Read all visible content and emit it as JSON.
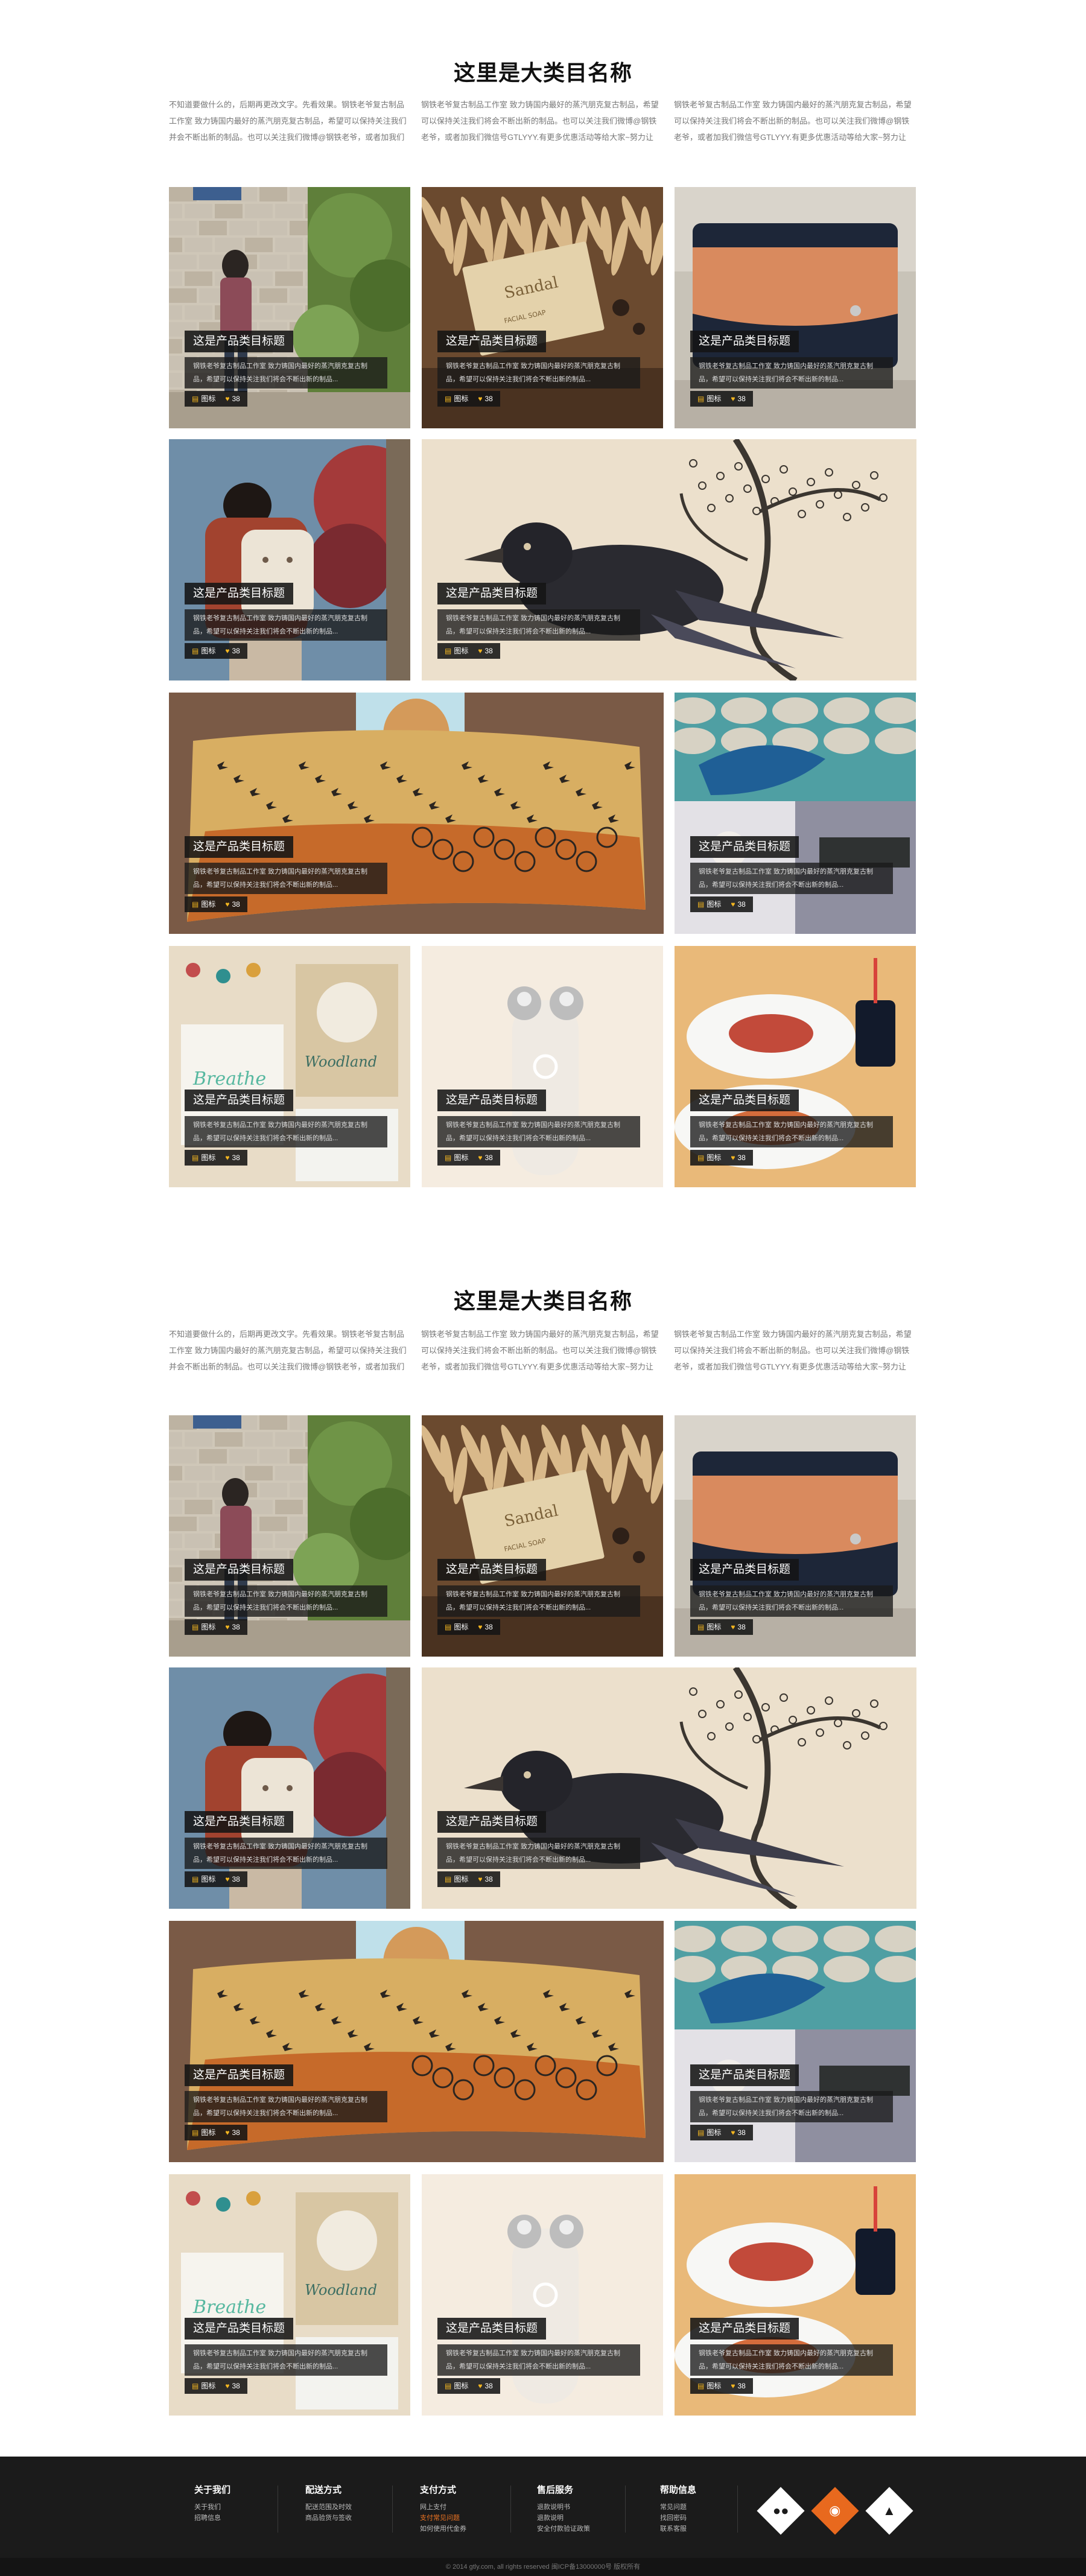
{
  "sections": [
    {
      "title": "这里是大类目名称",
      "intro": [
        "不知道要做什么的，后期再更改文字。先看效果。钢铁老爷复古制品工作室 致力铸国内最好的蒸汽朋克复古制品，希望可以保持关注我们并会不断出新的制品。也可以关注我们微博@钢铁老爷，或者加我们微信号GTLYYY...",
        "钢铁老爷复古制品工作室 致力铸国内最好的蒸汽朋克复古制品，希望可以保持关注我们将会不断出新的制品。也可以关注我们微博@钢铁老爷，或者加我们微信号GTLYYY.有更多优惠活动等给大家~努力让【钢铁老爷】成为年轻人的复古品牌...",
        "钢铁老爷复古制品工作室 致力铸国内最好的蒸汽朋克复古制品，希望可以保持关注我们将会不断出新的制品。也可以关注我们微博@钢铁老爷，或者加我们微信号GTLYYY.有更多优惠活动等给大家~努力让【钢铁老爷】成为年轻人的复古品牌..."
      ]
    },
    {
      "title": "这里是大类目名称",
      "intro": [
        "不知道要做什么的，后期再更改文字。先看效果。钢铁老爷复古制品工作室 致力铸国内最好的蒸汽朋克复古制品，希望可以保持关注我们并会不断出新的制品。也可以关注我们微博@钢铁老爷，或者加我们微信号GTLYYY...",
        "钢铁老爷复古制品工作室 致力铸国内最好的蒸汽朋克复古制品，希望可以保持关注我们将会不断出新的制品。也可以关注我们微博@钢铁老爷，或者加我们微信号GTLYYY.有更多优惠活动等给大家~努力让【钢铁老爷】成为年轻人的复古品牌...",
        "钢铁老爷复古制品工作室 致力铸国内最好的蒸汽朋克复古制品，希望可以保持关注我们将会不断出新的制品。也可以关注我们微博@钢铁老爷，或者加我们微信号GTLYYY.有更多优惠活动等给大家~努力让【钢铁老爷】成为年轻人的复古品牌..."
      ]
    }
  ],
  "card": {
    "title": "这是产品类目标题",
    "desc": "钢铁老爷复古制品工作室 致力铸国内最好的蒸汽朋克复古制品，希望可以保持关注我们将会不断出新的制品...",
    "tag_label": "图标",
    "like_count": "38"
  },
  "tiles": [
    {
      "image": "brick-wall-boy-photo"
    },
    {
      "image": "facial-soap-photo"
    },
    {
      "image": "leather-wallet-photo"
    },
    {
      "image": "backpack-girl-photo"
    },
    {
      "image": "crow-branch-illustration"
    },
    {
      "image": "bird-scarf-photo"
    },
    {
      "image": "teal-ceramic-photo"
    },
    {
      "image": "breathe-woodland-prints-photo"
    },
    {
      "image": "face-roller-device-photo"
    },
    {
      "image": "food-plates-photo"
    }
  ],
  "footer": {
    "columns": [
      {
        "heading": "关于我们",
        "links": [
          "关于我们",
          "招聘信息"
        ]
      },
      {
        "heading": "配送方式",
        "links": [
          "配送范围及时效",
          "商品验货与签收"
        ]
      },
      {
        "heading": "支付方式",
        "links": [
          "网上支付",
          "支付常见问题",
          "如何使用代金券"
        ]
      },
      {
        "heading": "售后服务",
        "links": [
          "退款说明书",
          "退款说明",
          "安全付款验证政策"
        ]
      },
      {
        "heading": "帮助信息",
        "links": [
          "常见问题",
          "找回密码",
          "联系客服"
        ]
      }
    ],
    "highlight_link": "支付常见问题",
    "social": [
      {
        "icon": "wechat-icon",
        "color": "#ffffff"
      },
      {
        "icon": "weibo-icon",
        "color": "#e8691e"
      },
      {
        "icon": "qq-icon",
        "color": "#ffffff"
      }
    ],
    "copyright": "© 2014 gtly.com, all rights reserved   闽ICP备13000000号 版权所有"
  },
  "colors": {
    "accent": "#f3b620",
    "footer_bg": "#1b1b1b",
    "highlight": "#ee7422"
  }
}
